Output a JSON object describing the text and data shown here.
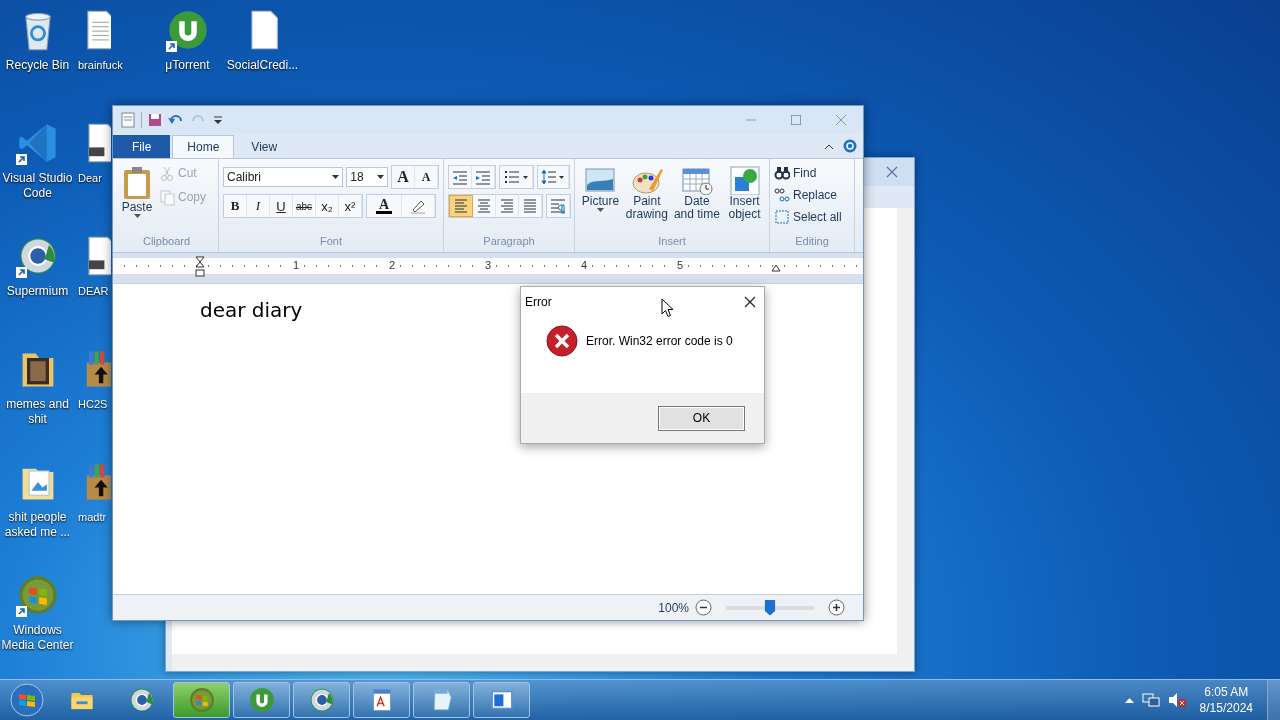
{
  "desktop_icons": [
    [
      {
        "label": "Recycle Bin",
        "kind": "recycle",
        "shortcut": false
      },
      {
        "label": "Visual Studio Code",
        "kind": "vscode",
        "shortcut": true
      },
      {
        "label": "Supermium",
        "kind": "browser",
        "shortcut": true
      },
      {
        "label": "memes and shit",
        "kind": "folder",
        "shortcut": false
      },
      {
        "label": "shit people asked me ...",
        "kind": "picture-folder",
        "shortcut": false
      },
      {
        "label": "Windows Media Center",
        "kind": "media-center",
        "shortcut": true
      }
    ],
    [
      {
        "label": "brainfuck",
        "kind": "text-file",
        "shortcut": false
      },
      {
        "label": "Dear",
        "kind": "word-doc",
        "shortcut": false
      },
      {
        "label": "DEAR",
        "kind": "word-doc",
        "shortcut": false
      },
      {
        "label": "HC2S",
        "kind": "installer",
        "shortcut": false
      },
      {
        "label": "madtr",
        "kind": "installer",
        "shortcut": false
      }
    ],
    [
      {
        "label": "μTorrent",
        "kind": "utorrent",
        "shortcut": true
      }
    ],
    [
      {
        "label": "SocialCredi...",
        "kind": "blank-file",
        "shortcut": false
      }
    ]
  ],
  "wordpad": {
    "tabs": [
      {
        "label": "File",
        "kind": "file",
        "selected": false
      },
      {
        "label": "Home",
        "kind": "tab",
        "selected": true
      },
      {
        "label": "View",
        "kind": "tab",
        "selected": false
      }
    ],
    "ribbon": {
      "clipboard": {
        "label": "Clipboard",
        "paste": "Paste",
        "items": [
          {
            "label": "Cut",
            "kind": "cut",
            "disabled": true
          },
          {
            "label": "Copy",
            "kind": "copy",
            "disabled": true
          }
        ]
      },
      "font": {
        "label": "Font",
        "family": "Calibri",
        "size": "18",
        "grow": "A",
        "shrink": "A",
        "formats": [
          "B",
          "I",
          "U",
          "abc",
          "x₂",
          "x²"
        ],
        "color_button": "A"
      },
      "paragraph": {
        "label": "Paragraph",
        "alignment": [
          {
            "selected": true
          },
          {
            "selected": false
          },
          {
            "selected": false
          },
          {
            "selected": false
          }
        ]
      },
      "insert": {
        "label": "Insert",
        "items": [
          {
            "label": "Picture",
            "kind": "picture",
            "dropdown": true
          },
          {
            "label": "Paint drawing",
            "kind": "paint",
            "dropdown": false
          },
          {
            "label": "Date and time",
            "kind": "calendar",
            "dropdown": false
          },
          {
            "label": "Insert object",
            "kind": "object",
            "dropdown": false
          }
        ]
      },
      "editing": {
        "label": "Editing",
        "items": [
          {
            "label": "Find",
            "kind": "find"
          },
          {
            "label": "Replace",
            "kind": "replace"
          },
          {
            "label": "Select all",
            "kind": "select-all"
          }
        ]
      }
    },
    "ruler": [
      "1",
      "2",
      "3",
      "4",
      "5"
    ],
    "document": {
      "text": "dear diary"
    },
    "status_bar": {
      "zoom": "100%",
      "level": 0.5
    }
  },
  "dialog": {
    "title": "Error",
    "message": "Error. Win32 error code is 0",
    "button": "OK"
  },
  "taskbar": {
    "items": [
      {
        "kind": "explorer",
        "running": false
      },
      {
        "kind": "browser",
        "running": false
      },
      {
        "kind": "media-center",
        "running": true
      },
      {
        "kind": "utorrent",
        "running": true
      },
      {
        "kind": "browser",
        "running": true
      },
      {
        "kind": "wordpad",
        "running": true
      },
      {
        "kind": "notepad",
        "running": true
      },
      {
        "kind": "window",
        "running": true
      }
    ],
    "clock": {
      "time": "6:05 AM",
      "date": "8/15/2024"
    }
  }
}
